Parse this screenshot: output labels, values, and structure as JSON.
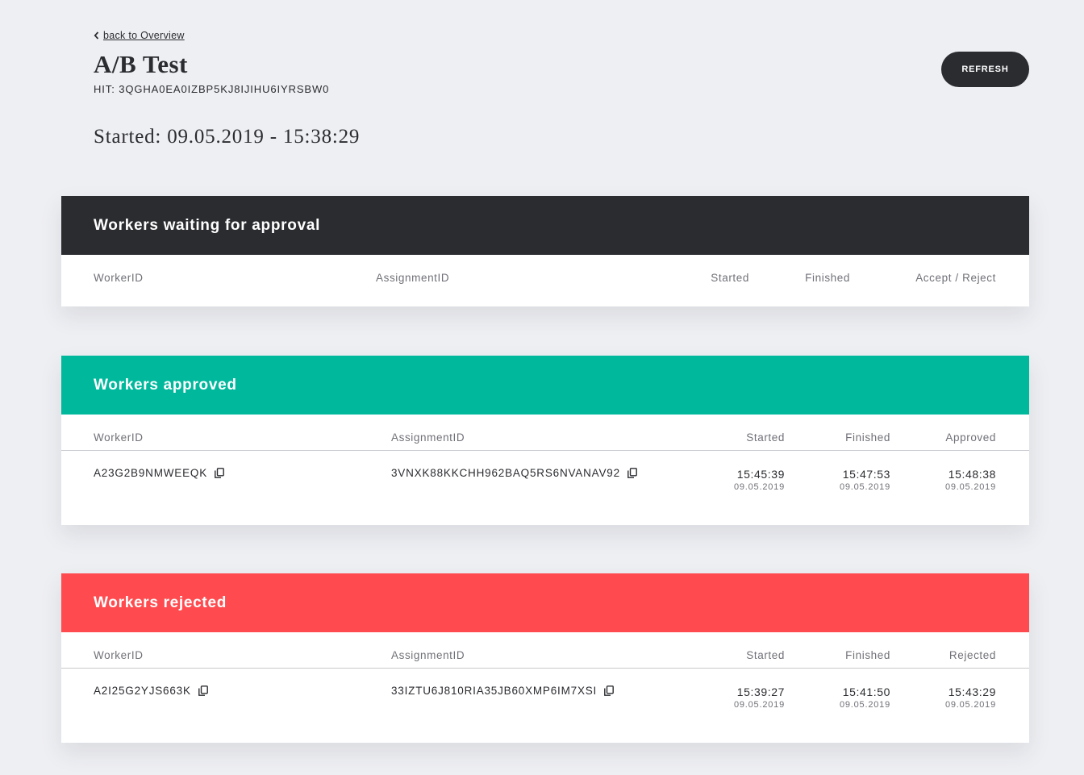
{
  "back_link": {
    "label": "back to Overview"
  },
  "page": {
    "title": "A/B Test",
    "hit": "HIT: 3QGHA0EA0IZBP5KJ8IJIHU6IYRSBW0",
    "started": "Started: 09.05.2019 - 15:38:29",
    "refresh_label": "REFRESH"
  },
  "colors": {
    "waiting": "#2b2c30",
    "approved": "#00b89c",
    "rejected": "#ff4b4f",
    "background": "#eeeff3"
  },
  "waiting": {
    "title": "Workers waiting for approval",
    "columns": [
      "WorkerID",
      "AssignmentID",
      "Started",
      "Finished",
      "Accept / Reject"
    ]
  },
  "approved": {
    "title": "Workers approved",
    "columns": [
      "WorkerID",
      "AssignmentID",
      "Started",
      "Finished",
      "Approved"
    ],
    "rows": [
      {
        "worker_id": "A23G2B9NMWEEQK",
        "assignment_id": "3VNXK88KKCHH962BAQ5RS6NVANAV92",
        "started_time": "15:45:39",
        "started_date": "09.05.2019",
        "finished_time": "15:47:53",
        "finished_date": "09.05.2019",
        "status_time": "15:48:38",
        "status_date": "09.05.2019"
      }
    ]
  },
  "rejected": {
    "title": "Workers rejected",
    "columns": [
      "WorkerID",
      "AssignmentID",
      "Started",
      "Finished",
      "Rejected"
    ],
    "rows": [
      {
        "worker_id": "A2I25G2YJS663K",
        "assignment_id": "33IZTU6J810RIA35JB60XMP6IM7XSI",
        "started_time": "15:39:27",
        "started_date": "09.05.2019",
        "finished_time": "15:41:50",
        "finished_date": "09.05.2019",
        "status_time": "15:43:29",
        "status_date": "09.05.2019"
      }
    ]
  },
  "icons": {
    "back": "chevron-left-icon",
    "copy": "copy-icon"
  }
}
